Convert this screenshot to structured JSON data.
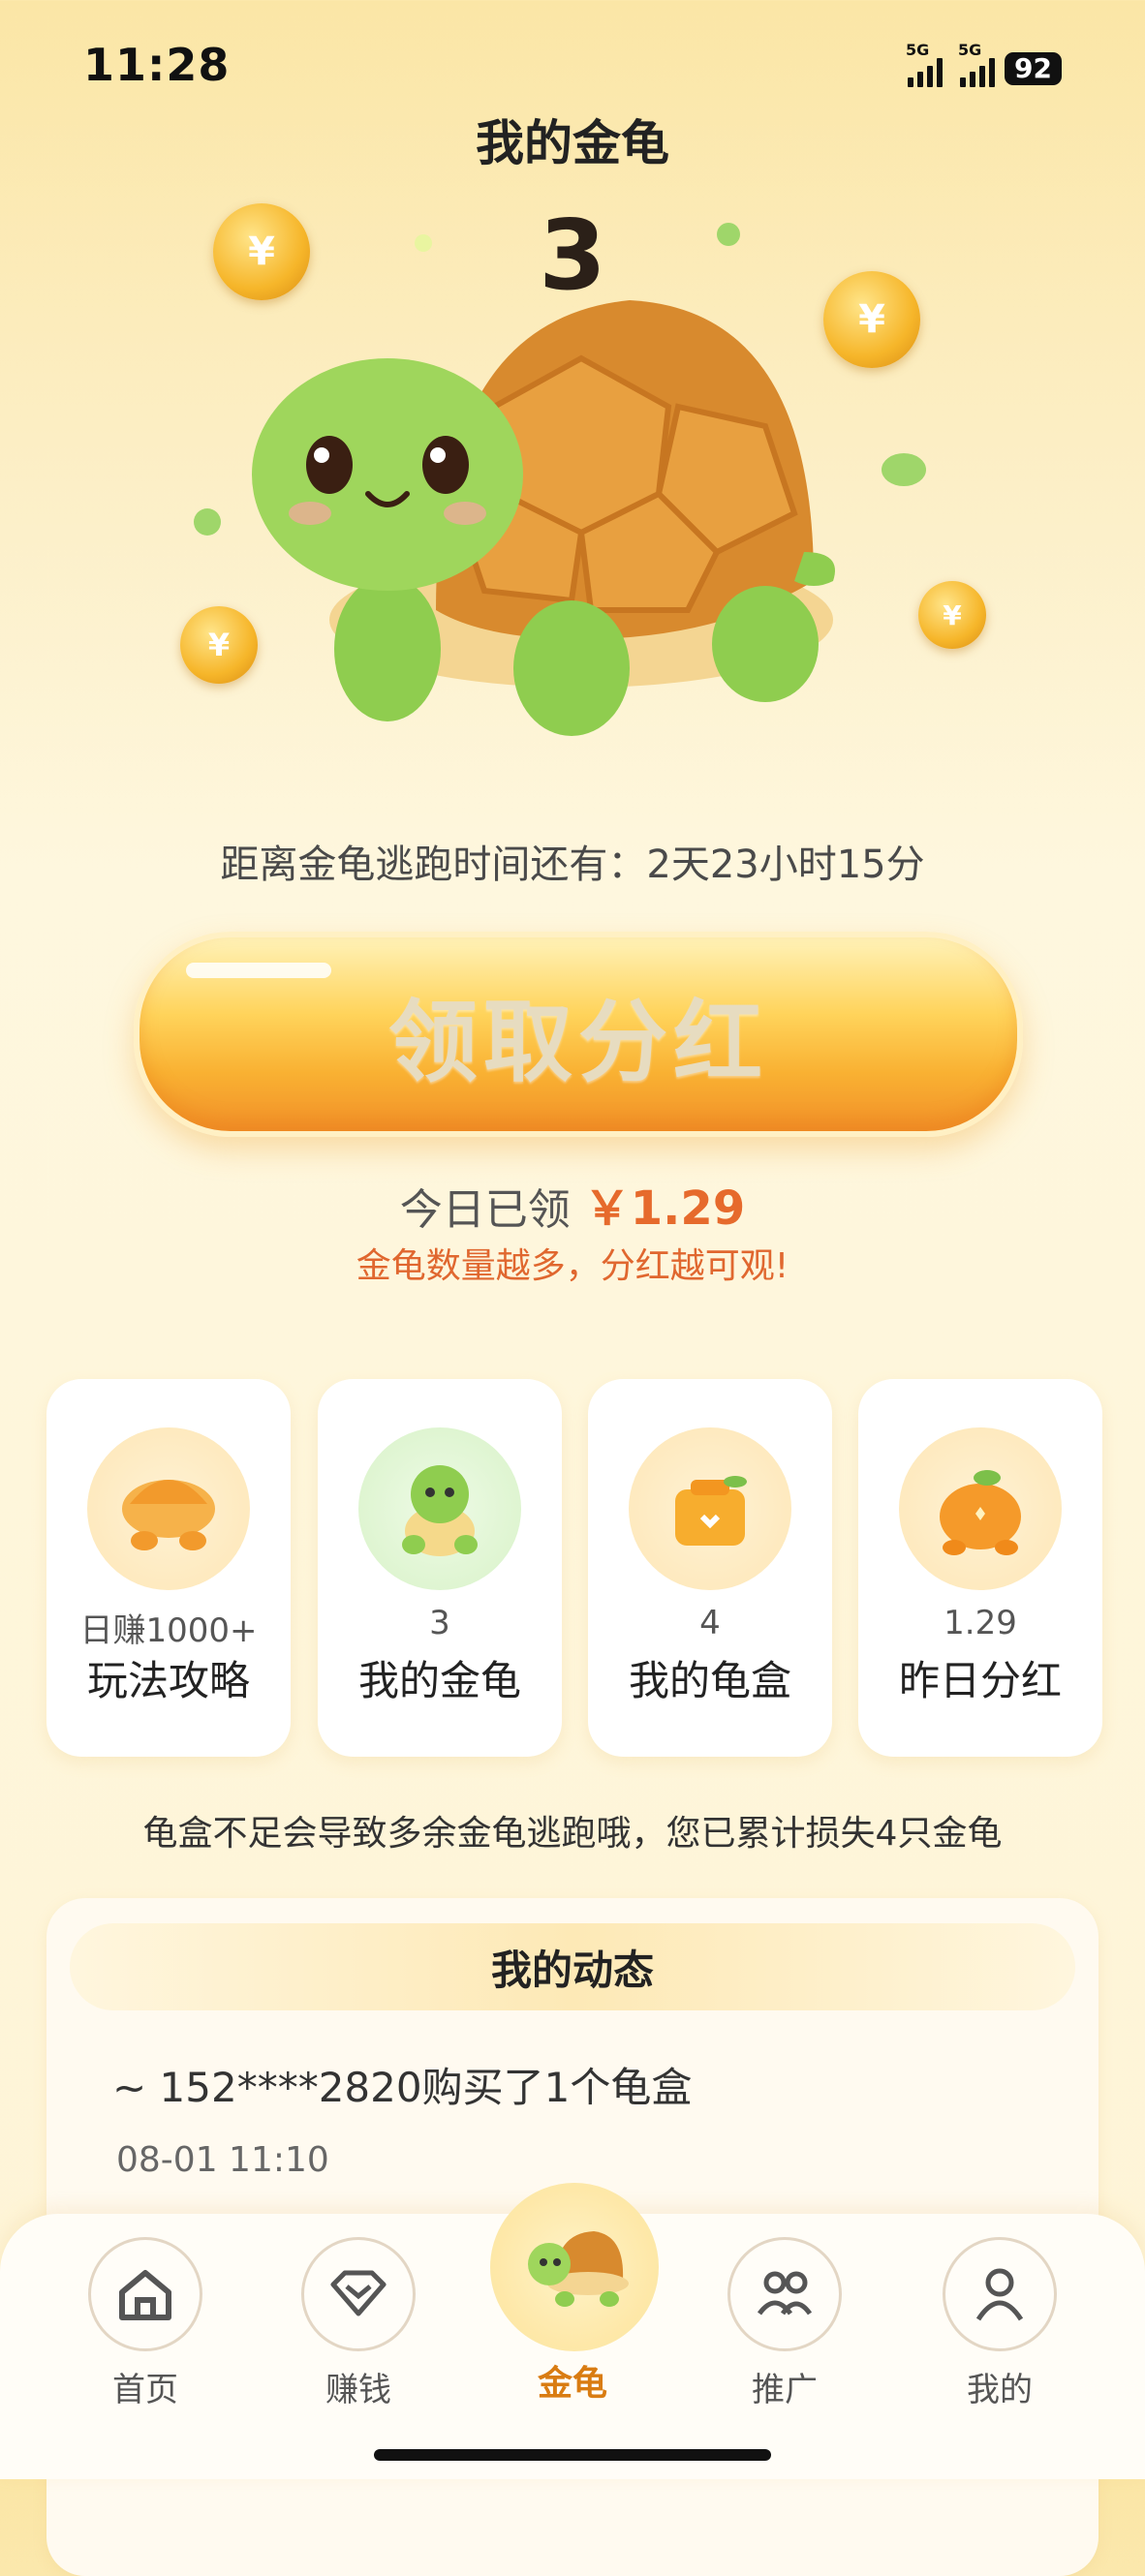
{
  "status": {
    "time": "11:28",
    "signal1": "5G",
    "signal2": "5G",
    "battery": "92"
  },
  "page": {
    "title": "我的金龟",
    "turtle_count": "3"
  },
  "countdown": {
    "text": "距离金龟逃跑时间还有：2天23小时15分"
  },
  "claim": {
    "button_label": "领取分红",
    "today_prefix": "今日已领",
    "today_amount": "￥1.29",
    "tip": "金龟数量越多，分红越可观!"
  },
  "cards": [
    {
      "value": "日赚1000+",
      "label": "玩法攻略",
      "icon": "turtle-shell-icon"
    },
    {
      "value": "3",
      "label": "我的金龟",
      "icon": "turtle-icon"
    },
    {
      "value": "4",
      "label": "我的龟盒",
      "icon": "box-icon"
    },
    {
      "value": "1.29",
      "label": "昨日分红",
      "icon": "orange-icon"
    }
  ],
  "warning": "龟盒不足会导致多余金龟逃跑哦，您已累计损失4只金龟",
  "activity": {
    "title": "我的动态",
    "items": [
      {
        "text": "~ 152****2820购买了1个龟盒",
        "time": "08-01 11:10"
      }
    ]
  },
  "tabs": [
    {
      "label": "首页",
      "icon": "home-icon"
    },
    {
      "label": "赚钱",
      "icon": "diamond-icon"
    },
    {
      "label": "金龟",
      "icon": "turtle-icon"
    },
    {
      "label": "推广",
      "icon": "people-icon"
    },
    {
      "label": "我的",
      "icon": "user-icon"
    }
  ],
  "colors": {
    "accent": "#e66a2c",
    "active_tab": "#d97c12",
    "coin": "#f6b62a"
  }
}
